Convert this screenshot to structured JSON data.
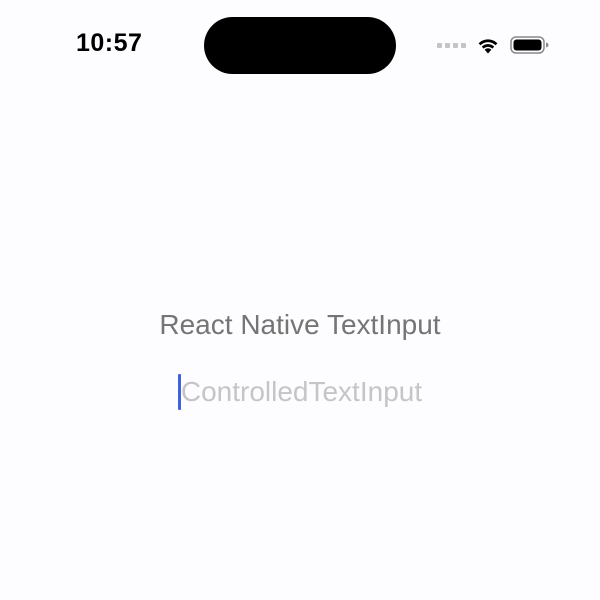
{
  "status_bar": {
    "time": "10:57",
    "icons": [
      "cellular-signal-icon",
      "wifi-icon",
      "battery-icon"
    ]
  },
  "inputs": [
    {
      "placeholder": "React Native TextInput",
      "value": "",
      "focused": false
    },
    {
      "placeholder": "ControlledTextInput",
      "value": "",
      "focused": true
    }
  ],
  "colors": {
    "background": "#fdfcfe",
    "placeholder": "#c5c5c8",
    "caret": "#3f63e0",
    "signal_inactive": "#c4c4c6"
  }
}
